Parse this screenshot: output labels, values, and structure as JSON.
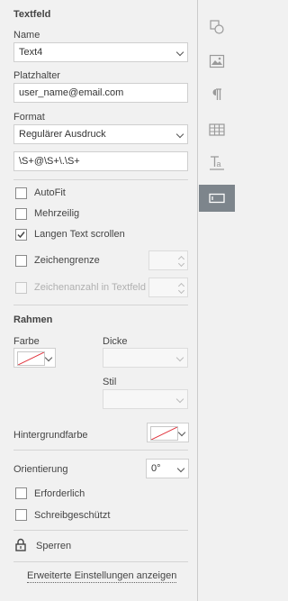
{
  "section_title": "Textfeld",
  "name": {
    "label": "Name",
    "value": "Text4"
  },
  "placeholder": {
    "label": "Platzhalter",
    "value": "user_name@email.com"
  },
  "format": {
    "label": "Format",
    "value": "Regulärer Ausdruck",
    "regex": "\\S+@\\S+\\.\\S+"
  },
  "checks": {
    "autofit": {
      "label": "AutoFit",
      "checked": false
    },
    "multiline": {
      "label": "Mehrzeilig",
      "checked": false
    },
    "scroll": {
      "label": "Langen Text scrollen",
      "checked": true
    },
    "charlimit": {
      "label": "Zeichengrenze",
      "checked": false
    },
    "comb": {
      "label": "Zeichenanzahl in Textfeld",
      "checked": false,
      "disabled": true
    }
  },
  "border": {
    "title": "Rahmen",
    "color_label": "Farbe",
    "width_label": "Dicke",
    "style_label": "Stil"
  },
  "background_label": "Hintergrundfarbe",
  "orientation": {
    "label": "Orientierung",
    "value": "0°"
  },
  "required": {
    "label": "Erforderlich",
    "checked": false
  },
  "readonly": {
    "label": "Schreibgeschützt",
    "checked": false
  },
  "lock_label": "Sperren",
  "advanced_link": "Erweiterte Einstellungen anzeigen",
  "colors": {
    "rail_active": "#7d858c",
    "no_color_line": "#e0303a"
  },
  "rail_icons": [
    "shape-icon",
    "image-icon",
    "paragraph-icon",
    "table-icon",
    "text-art-icon",
    "form-field-icon"
  ]
}
